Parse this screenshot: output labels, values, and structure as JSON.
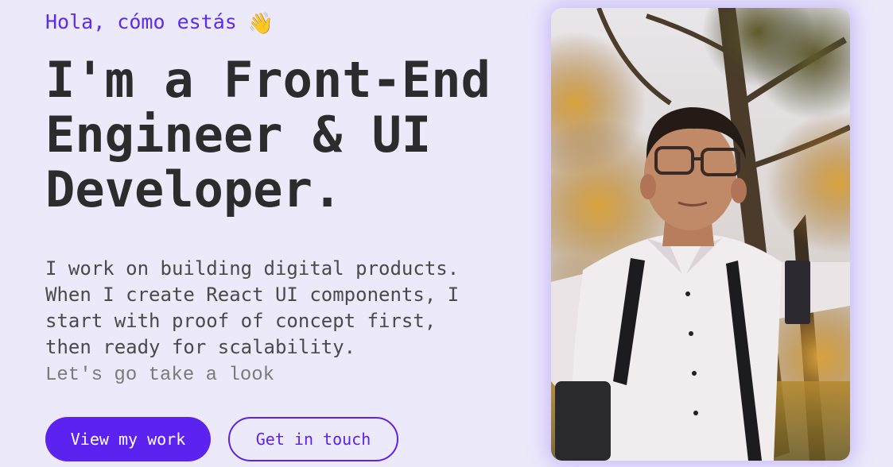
{
  "hero": {
    "greeting": "Hola, cómo estás",
    "wave_icon": "👋",
    "headline_lines": [
      "I'm a Front-End",
      "Engineer & UI",
      "Developer."
    ],
    "intro_lines": [
      "I work on building digital products.",
      "When I create React UI components, I",
      "start with proof of concept first,",
      "then ready for scalability."
    ],
    "tagline": "Let's go take a look",
    "primary_button": "View my work",
    "secondary_button": "Get in touch"
  },
  "colors": {
    "background": "#ece9fb",
    "accent": "#5b22f0",
    "heading": "#2c2c2c",
    "body_text": "#4a4a4a"
  },
  "photo": {
    "icon": "portrait-photo"
  }
}
